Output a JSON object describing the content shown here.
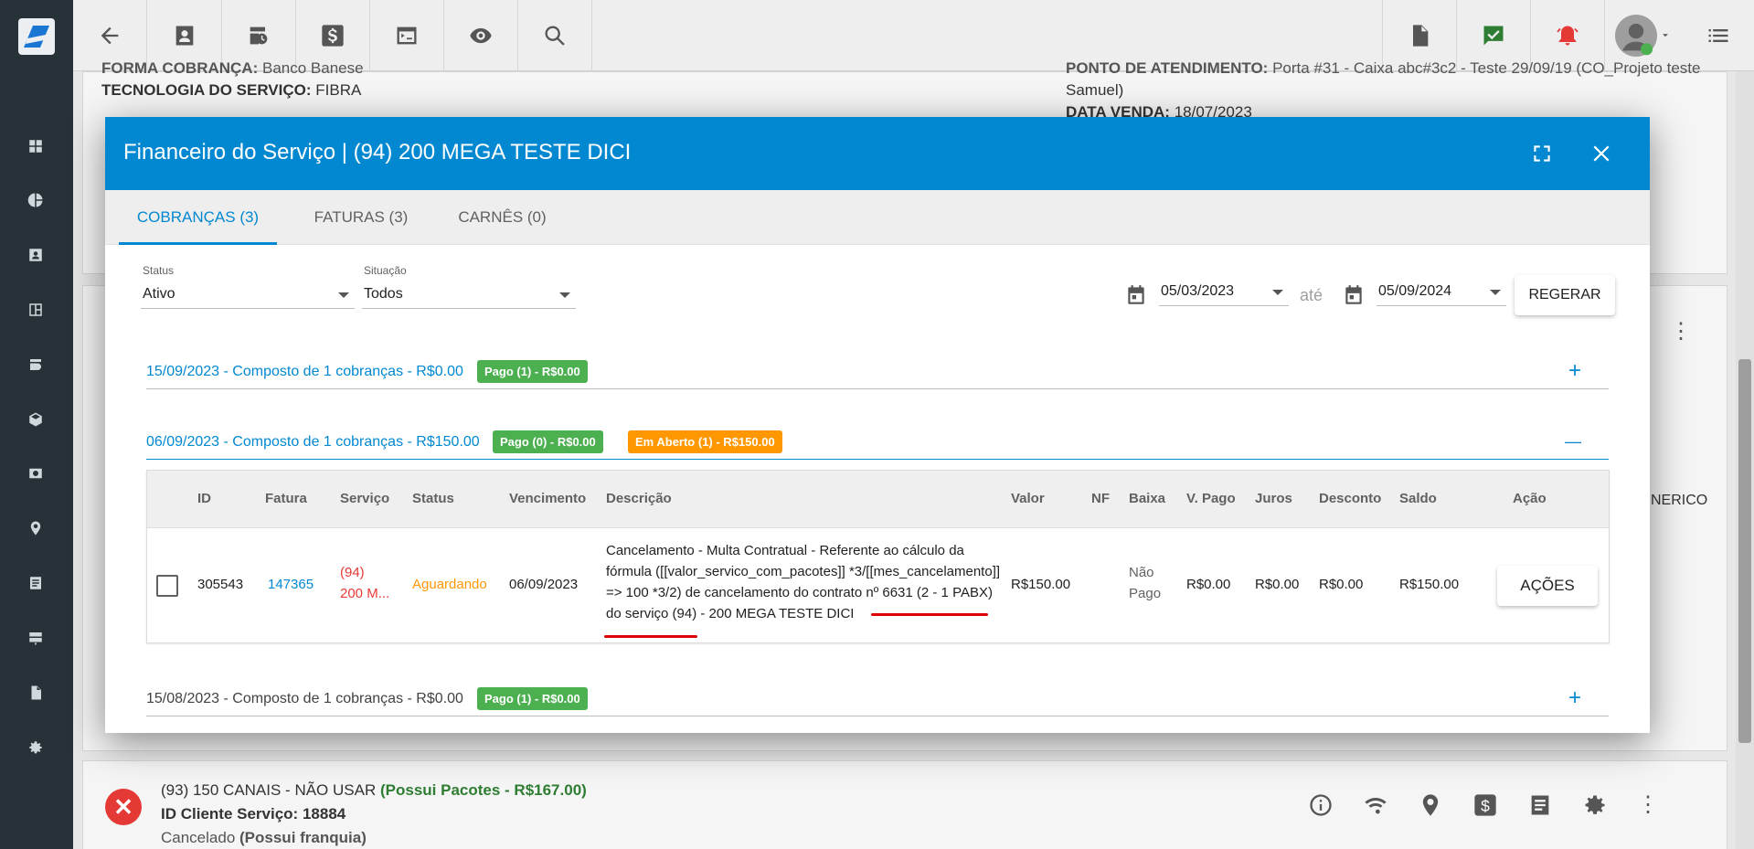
{
  "modal": {
    "title": "Financeiro do Serviço | (94) 200 MEGA TESTE DICI",
    "tabs": [
      "COBRANÇAS (3)",
      "FATURAS (3)",
      "CARNÊS (0)"
    ],
    "filters": {
      "status_label": "Status",
      "status_value": "Ativo",
      "situacao_label": "Situação",
      "situacao_value": "Todos",
      "date_from": "05/03/2023",
      "date_sep": "até",
      "date_to": "05/09/2024",
      "regen_button": "REGERAR"
    },
    "groups": [
      {
        "title": "15/09/2023 - Composto de 1 cobranças - R$0.00",
        "badges": [
          "Pago (1) - R$0.00"
        ],
        "toggle": "+"
      },
      {
        "title": "06/09/2023 - Composto de 1 cobranças - R$150.00",
        "badges": [
          "Pago (0) - R$0.00",
          "Em Aberto (1) - R$150.00"
        ],
        "toggle": "—"
      },
      {
        "title": "15/08/2023 - Composto de 1 cobranças - R$0.00",
        "badges": [
          "Pago (1) - R$0.00"
        ],
        "toggle": "+"
      }
    ],
    "table": {
      "headers": [
        "ID",
        "Fatura",
        "Serviço",
        "Status",
        "Vencimento",
        "Descrição",
        "Valor",
        "NF",
        "Baixa",
        "V. Pago",
        "Juros",
        "Desconto",
        "Saldo",
        "Ação"
      ],
      "row": {
        "id": "305543",
        "fatura": "147365",
        "servico_line1": "(94)",
        "servico_line2": "200 M...",
        "status": "Aguardando",
        "vencimento": "06/09/2023",
        "descricao": "Cancelamento - Multa Contratual - Referente ao cálculo da fórmula ([[valor_servico_com_pacotes]] *3/[[mes_cancelamento]] => 100 *3/2) de cancelamento do contrato nº 6631 (2 - 1 PABX) do serviço (94) - 200 MEGA TESTE DICI",
        "valor": "R$150.00",
        "nf": "",
        "baixa_line1": "Não",
        "baixa_line2": "Pago",
        "v_pago": "R$0.00",
        "juros": "R$0.00",
        "desconto": "R$0.00",
        "saldo": "R$150.00",
        "acao": "AÇÕES"
      }
    }
  },
  "background": {
    "forma_cobranca_label": "FORMA COBRANÇA:",
    "forma_cobranca_value": "Banco Banese",
    "tecnologia_label": "TECNOLOGIA DO SERVIÇO:",
    "tecnologia_value": "FIBRA",
    "ponto_label": "PONTO DE ATENDIMENTO:",
    "ponto_value": "Porta #31 - Caixa abc#3c2 - Teste 29/09/19 (CO_Projeto teste",
    "ponto_value2": "Samuel)",
    "data_venda_label": "DATA VENDA:",
    "data_venda_value": "18/07/2023",
    "generico_fragment": "NERICO",
    "service_line": "(93) 150 CANAIS - NÃO USAR",
    "service_pacotes": "(Possui Pacotes - R$167.00)",
    "id_cliente_label": "ID Cliente Serviço:",
    "id_cliente_value": "18884",
    "status_text": "Cancelado",
    "franquia": "(Possui franquia)"
  },
  "colors": {
    "primary": "#0288d1",
    "success": "#4caf50",
    "warning": "#ff9800",
    "danger": "#e53935",
    "sidebar": "#263238"
  }
}
